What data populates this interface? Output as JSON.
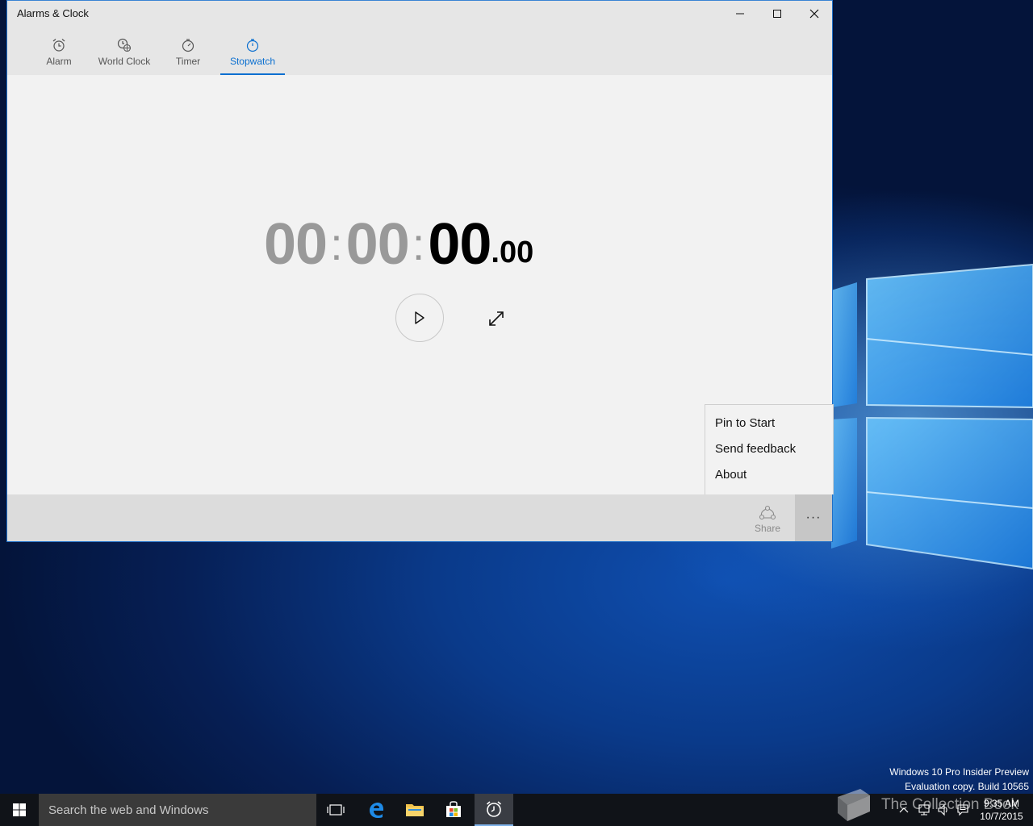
{
  "window": {
    "title": "Alarms & Clock",
    "controls": [
      "minimize-icon",
      "maximize-icon",
      "close-icon"
    ]
  },
  "tabs": [
    {
      "label": "Alarm",
      "icon": "alarm-clock-icon",
      "active": false
    },
    {
      "label": "World Clock",
      "icon": "world-clock-icon",
      "active": false
    },
    {
      "label": "Timer",
      "icon": "timer-icon",
      "active": false
    },
    {
      "label": "Stopwatch",
      "icon": "stopwatch-icon",
      "active": true
    }
  ],
  "stopwatch": {
    "hours": "00",
    "minutes": "00",
    "seconds": "00",
    "hundredths": ".00",
    "separator": ":"
  },
  "commandbar": {
    "share_label": "Share",
    "more_label": "···"
  },
  "menu": {
    "items": [
      "Pin to Start",
      "Send feedback",
      "About"
    ]
  },
  "watermark": {
    "line1": "Windows 10 Pro Insider Preview",
    "line2": "Evaluation copy. Build 10565"
  },
  "taskbar": {
    "search_placeholder": "Search the web and Windows",
    "time": "9:35 AM",
    "date": "10/7/2015"
  },
  "overlay": {
    "text": "The Collection Book"
  },
  "colors": {
    "accent": "#0a6fd0",
    "window_bg": "#f2f2f2",
    "taskbar_bg": "#101318"
  }
}
